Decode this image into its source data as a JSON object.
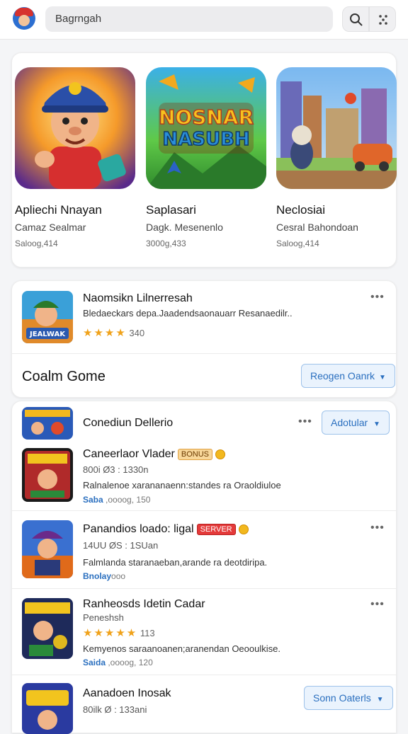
{
  "search": {
    "value": "Bagrngah"
  },
  "featured": [
    {
      "title": "Apliechi Nnayan",
      "subtitle": "Camaz Sealmar",
      "meta": "Saloog,414",
      "art": "mascot"
    },
    {
      "title": "Saplasari",
      "subtitle": "Dagk. Mesenenlo",
      "meta": "3000g,433",
      "art": "logo",
      "logo_line1": "NOSNAR",
      "logo_line2": "NASUBH"
    },
    {
      "title": "Neclosiai",
      "subtitle": "Cesral Bahondoan",
      "meta": "Saloog,414",
      "art": "city"
    }
  ],
  "highlight": {
    "title": "Naomsikn Lilnerresah",
    "description": "Bledaeckars depa.Jaadendsaonauarr Resanaedilr..",
    "rating": "340",
    "stars": 4,
    "thumb_text": "JEALWAK"
  },
  "section": {
    "title": "Coalm Gome",
    "button": "Reogen Oanrk"
  },
  "list_header": {
    "title": "Conediun Dellerio",
    "button": "Adotular",
    "more": "•••"
  },
  "list": [
    {
      "title": "Caneerlaor Vlader",
      "tag": "BONUS",
      "tag_style": "orange",
      "sub": "800i Ø3 : 1330n",
      "desc": "Ralnalenoe xarananaenn:standes ra Oraoldiuloe",
      "meta_hl": "Saba",
      "meta": " ,oooog, 150"
    },
    {
      "title": "Panandios loado: ligal",
      "tag": "SERVER",
      "tag_style": "red",
      "sub": "14UU ØS : 1SUan",
      "desc": "Falmlanda staranaeban,arande ra deotdiripa.",
      "meta_hl": "Bnolay",
      "meta": "ooo"
    },
    {
      "title": "Ranheosds Idetin Cadar",
      "sub": "Peneshsh",
      "stars": 5,
      "rating": "113",
      "desc": "Kemyenos saraanoanen;aranendan Oeooulkise.",
      "meta_hl": "Saida",
      "meta": " ,oooog, 120"
    },
    {
      "title": "Aanadoen Inosak",
      "sub": "80ilk Ø : 133ani",
      "button": "Sonn Oaterls"
    }
  ],
  "colors": {
    "accent": "#2a6fbf",
    "star": "#f0a21a",
    "background": "#f4f5f7"
  }
}
